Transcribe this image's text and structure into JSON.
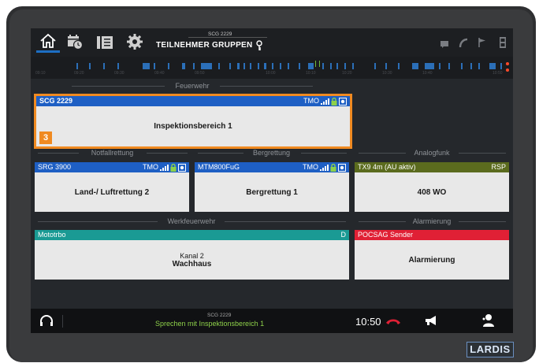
{
  "topbar": {
    "group_label": "SCG 2229",
    "nav": [
      "TEILNEHMER",
      "GRUPPEN"
    ]
  },
  "timeline": {
    "labels": [
      "09:10",
      "09:20",
      "09:30",
      "09:40",
      "09:50",
      "10:00",
      "10:10",
      "10:20",
      "10:30",
      "10:40",
      "10:50"
    ]
  },
  "groups": {
    "feuerwehr": "Feuerwehr",
    "notfallrettung": "Notfallrettung",
    "bergrettung": "Bergrettung",
    "analogfunk": "Analogfunk",
    "werkfeuerwehr": "Werkfeuerwehr",
    "alarmierung": "Alarmierung"
  },
  "cards": {
    "scg": {
      "name": "SCG 2229",
      "mode": "TMO",
      "body": "Inspektionsbereich 1",
      "badge": "3",
      "color": "#1e5fc4"
    },
    "srg": {
      "name": "SRG 3900",
      "mode": "TMO",
      "body": "Land-/ Luftrettung 2",
      "color": "#1e5fc4"
    },
    "mtm": {
      "name": "MTM800FuG",
      "mode": "TMO",
      "body": "Bergrettung 1",
      "color": "#1e5fc4"
    },
    "tx9": {
      "name": "TX9 4m (AU aktiv)",
      "mode": "RSP",
      "body": "408 WO",
      "color": "#5b6b1e"
    },
    "moto": {
      "name": "Mototrbo",
      "mode": "D",
      "sub": "Kanal 2",
      "body": "Wachhaus",
      "color": "#1a9a94"
    },
    "pocsag": {
      "name": "POCSAG Sender",
      "body": "Alarmierung",
      "color": "#e02035"
    }
  },
  "bottombar": {
    "group": "SCG 2229",
    "status": "Sprechen mit Inspektionsbereich 1",
    "time": "10:50"
  },
  "brand": "LARDIS",
  "colors": {
    "accent": "#1e5fc4",
    "selected_border": "#f08a21",
    "status_text": "#8ed14a"
  }
}
